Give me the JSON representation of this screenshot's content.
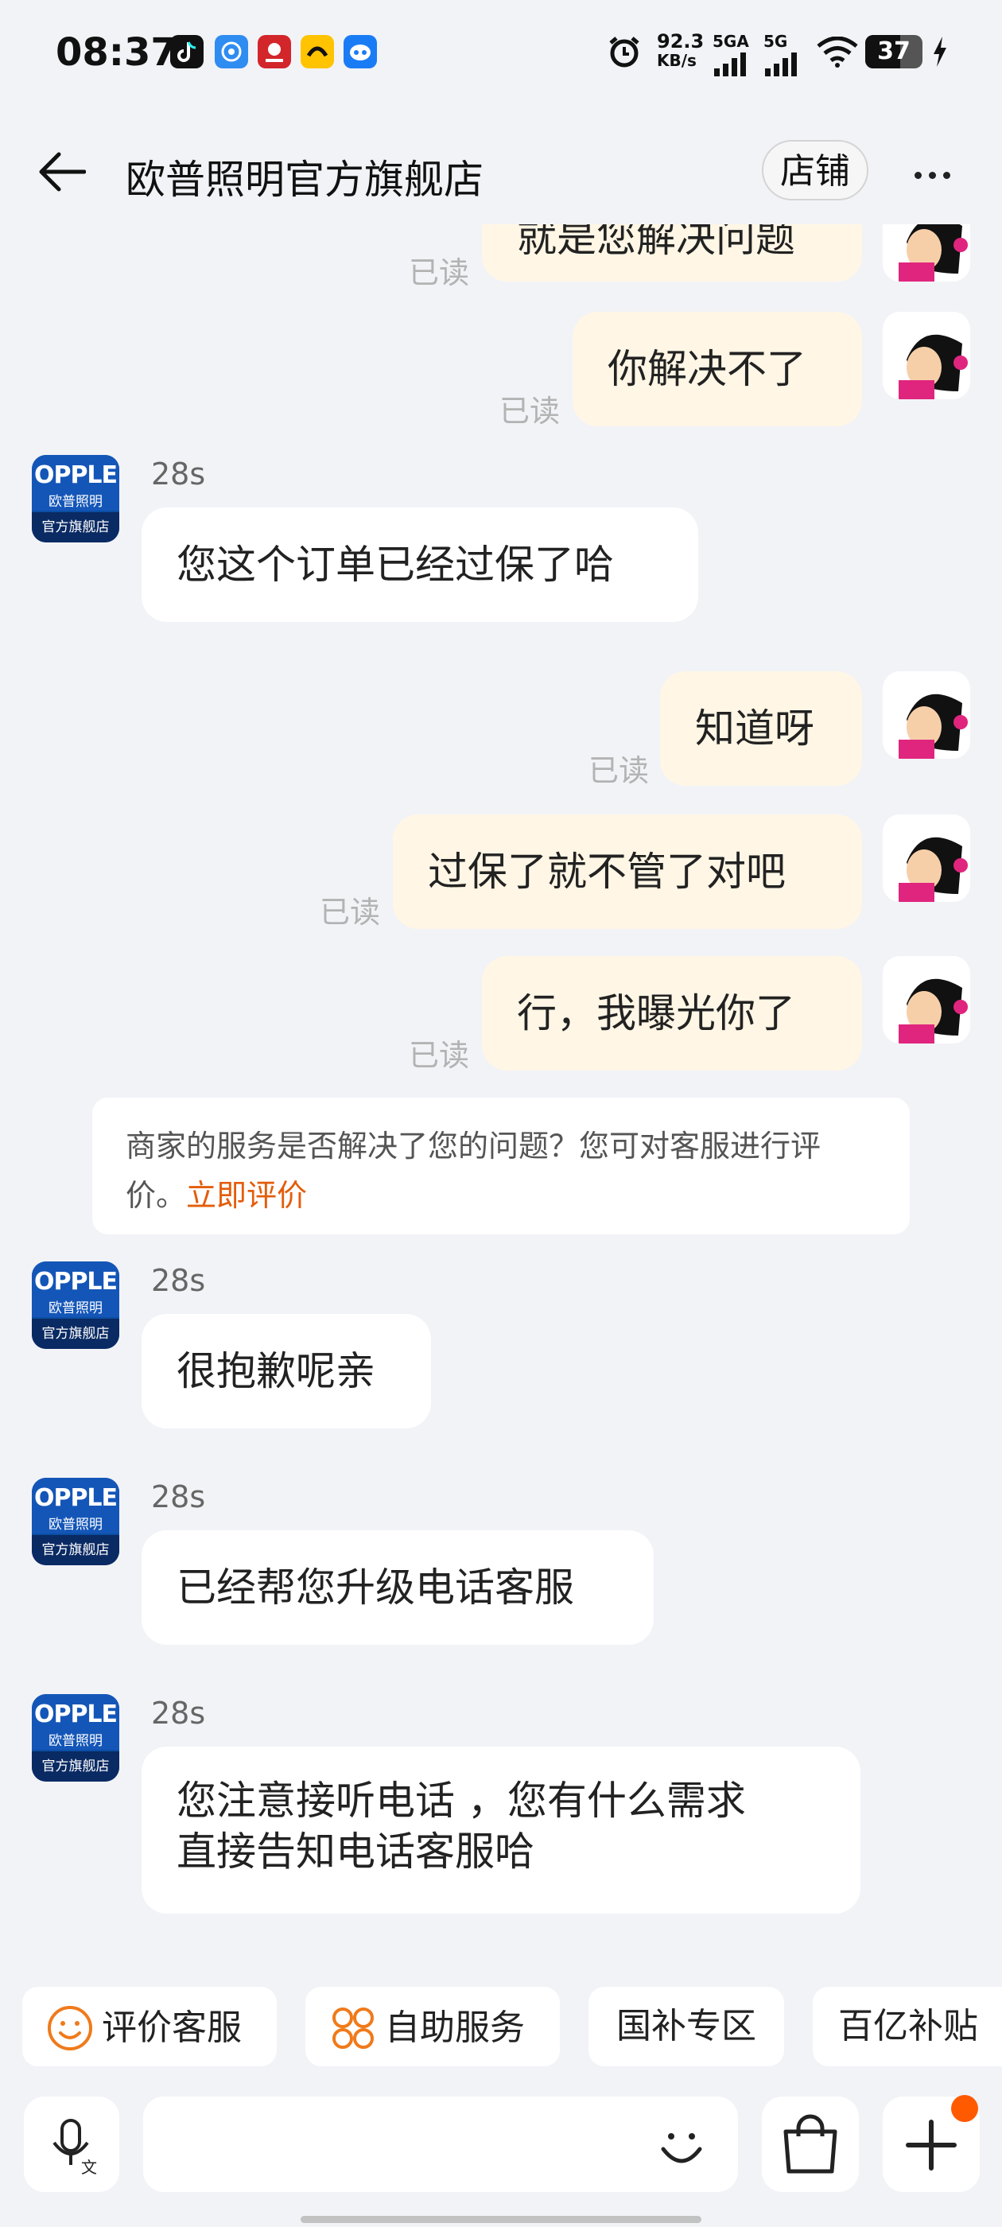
{
  "status_bar": {
    "time": "08:37",
    "net_speed_value": "92.3",
    "net_speed_unit": "KB/s",
    "net1": "5GA",
    "net2": "5G",
    "battery": "37"
  },
  "header": {
    "title": "欧普照明官方旗舰店",
    "store_button": "店铺",
    "back_icon": "arrow-left-icon",
    "more_icon": "more-dots-icon"
  },
  "shop": {
    "logo_text": "OPPLE",
    "logo_sub": "欧普照明",
    "logo_bottom": "官方旗舰店"
  },
  "messages": [
    {
      "sender": "me",
      "text": "就是您解决问题",
      "status": "已读"
    },
    {
      "sender": "me",
      "text": "你解决不了",
      "status": "已读"
    },
    {
      "sender": "shop",
      "time": "28s",
      "text": "您这个订单已经过保了哈"
    },
    {
      "sender": "me",
      "text": "知道呀",
      "status": "已读"
    },
    {
      "sender": "me",
      "text": "过保了就不管了对吧",
      "status": "已读"
    },
    {
      "sender": "me",
      "text": "行，我曝光你了",
      "status": "已读"
    },
    {
      "sender": "shop",
      "time": "28s",
      "text": "很抱歉呢亲"
    },
    {
      "sender": "shop",
      "time": "28s",
      "text": "已经帮您升级电话客服"
    },
    {
      "sender": "shop",
      "time": "28s",
      "text_line1": "您注意接听电话 ，您有什么需求",
      "text_line2": "直接告知电话客服哈"
    }
  ],
  "notice": {
    "text": "商家的服务是否解决了您的问题？您可对客服进行评价。",
    "link": "立即评价"
  },
  "quick_actions": [
    {
      "label": "评价客服",
      "icon": "smile-icon"
    },
    {
      "label": "自助服务",
      "icon": "grid-circles-icon"
    },
    {
      "label": "国补专区"
    },
    {
      "label": "百亿补贴"
    }
  ],
  "input_bar": {
    "voice_icon": "mic-text-icon",
    "emoji_icon": "smile-face-icon",
    "shop_icon": "shopping-bag-icon",
    "plus_icon": "plus-icon"
  },
  "colors": {
    "my_bubble": "#fff6e5",
    "their_bubble": "#ffffff",
    "background": "#f2f3f7",
    "link": "#e35d0b",
    "badge": "#ff5a00"
  }
}
